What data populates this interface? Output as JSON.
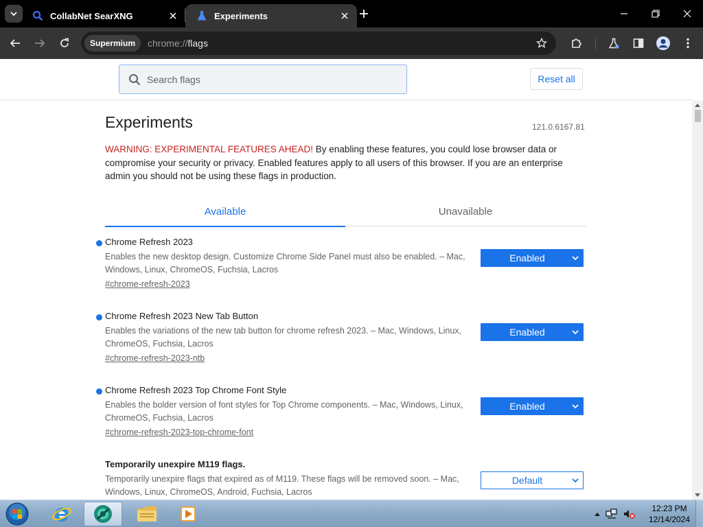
{
  "browser": {
    "tabs": [
      {
        "title": "CollabNet SearXNG",
        "icon": "search-icon",
        "active": false
      },
      {
        "title": "Experiments",
        "icon": "flask-icon",
        "active": true
      }
    ],
    "toolbar": {
      "chip_label": "Supermium",
      "url_scheme": "chrome://",
      "url_host": "flags"
    }
  },
  "flags_page": {
    "search_placeholder": "Search flags",
    "reset_all_label": "Reset all",
    "title": "Experiments",
    "version": "121.0.6167.81",
    "warning_lead": "WARNING: EXPERIMENTAL FEATURES AHEAD!",
    "warning_body": " By enabling these features, you could lose browser data or compromise your security or privacy. Enabled features apply to all users of this browser. If you are an enterprise admin you should not be using these flags in production.",
    "tabs": [
      {
        "label": "Available",
        "selected": true
      },
      {
        "label": "Unavailable",
        "selected": false
      }
    ],
    "flags": [
      {
        "name": "Chrome Refresh 2023",
        "description": "Enables the new desktop design. Customize Chrome Side Panel must also be enabled. – Mac, Windows, Linux, ChromeOS, Fuchsia, Lacros",
        "link": "#chrome-refresh-2023",
        "value": "Enabled",
        "modified": true
      },
      {
        "name": "Chrome Refresh 2023 New Tab Button",
        "description": "Enables the variations of the new tab button for chrome refresh 2023. – Mac, Windows, Linux, ChromeOS, Fuchsia, Lacros",
        "link": "#chrome-refresh-2023-ntb",
        "value": "Enabled",
        "modified": true
      },
      {
        "name": "Chrome Refresh 2023 Top Chrome Font Style",
        "description": "Enables the bolder version of font styles for Top Chrome components. – Mac, Windows, Linux, ChromeOS, Fuchsia, Lacros",
        "link": "#chrome-refresh-2023-top-chrome-font",
        "value": "Enabled",
        "modified": true
      },
      {
        "name": "Temporarily unexpire M119 flags.",
        "description": "Temporarily unexpire flags that expired as of M119. These flags will be removed soon. – Mac, Windows, Linux, ChromeOS, Android, Fuchsia, Lacros",
        "link": "",
        "value": "Default",
        "modified": false
      }
    ]
  },
  "taskbar": {
    "pinned": [
      "internet-explorer-icon",
      "supermium-icon",
      "file-explorer-icon",
      "media-player-icon"
    ],
    "clock_time": "12:23 PM",
    "clock_date": "12/14/2024"
  },
  "colors": {
    "accent": "#1a73e8",
    "warning": "#c5221f",
    "tab_strip": "#000000",
    "toolbar": "#353535"
  }
}
